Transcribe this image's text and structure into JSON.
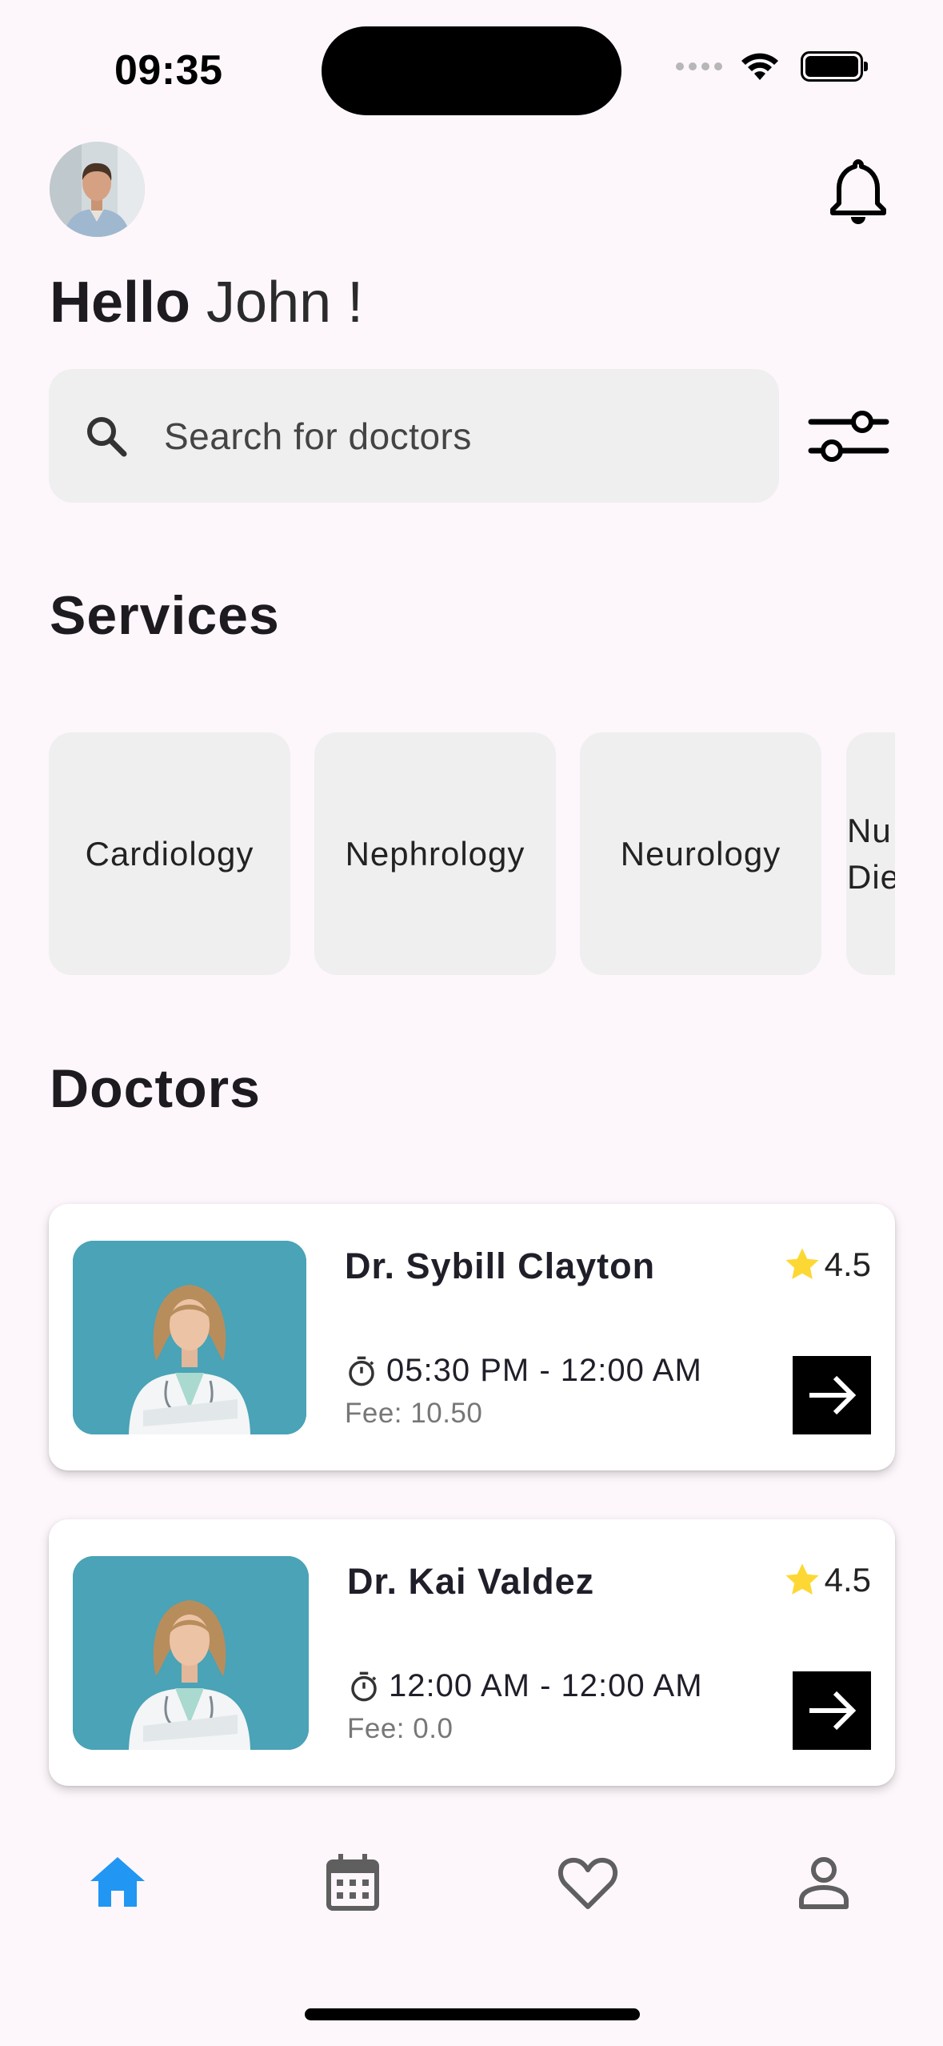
{
  "status_bar": {
    "time": "09:35"
  },
  "header": {
    "greeting_bold": "Hello",
    "greeting_name": "John !"
  },
  "search": {
    "placeholder": "Search for doctors"
  },
  "sections": {
    "services_title": "Services",
    "doctors_title": "Doctors"
  },
  "services": [
    {
      "label": "Cardiology"
    },
    {
      "label": "Nephrology"
    },
    {
      "label": "Neurology"
    },
    {
      "label_line1": "Nu",
      "label_line2": "Die"
    }
  ],
  "doctors": [
    {
      "name": "Dr. Sybill Clayton",
      "rating": "4.5",
      "hours": "05:30 PM - 12:00 AM",
      "fee": "Fee: 10.50"
    },
    {
      "name": "Dr. Kai Valdez",
      "rating": "4.5",
      "hours": "12:00 AM - 12:00 AM",
      "fee": "Fee: 0.0"
    }
  ],
  "bottom_nav": [
    {
      "icon": "home-icon",
      "active": true
    },
    {
      "icon": "calendar-icon",
      "active": false
    },
    {
      "icon": "heart-icon",
      "active": false
    },
    {
      "icon": "person-icon",
      "active": false
    }
  ],
  "colors": {
    "background": "#fdf7fc",
    "accent": "#2196f3",
    "star": "#fdd835",
    "card_bg": "#ffffff",
    "chip_bg": "#efefef"
  }
}
